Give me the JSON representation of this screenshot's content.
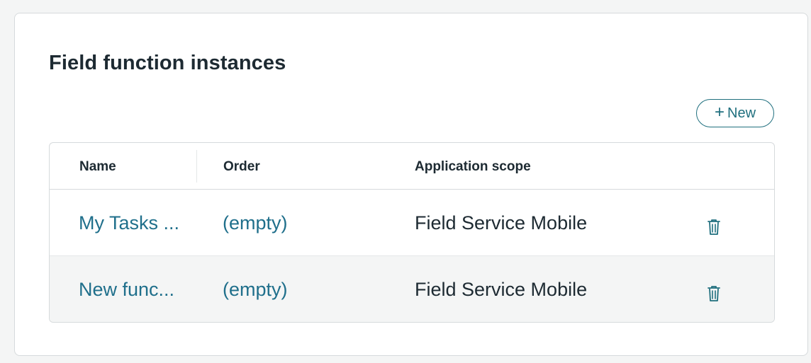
{
  "section": {
    "title": "Field function instances",
    "new_button_label": "New"
  },
  "table": {
    "columns": [
      "Name",
      "Order",
      "Application scope"
    ],
    "rows": [
      {
        "name": "My Tasks ...",
        "order": "(empty)",
        "scope": "Field Service Mobile"
      },
      {
        "name": "New func...",
        "order": "(empty)",
        "scope": "Field Service Mobile"
      }
    ]
  },
  "icons": {
    "new_button": "plus-icon",
    "row_action": "trash-icon"
  },
  "colors": {
    "link": "#1f6f8b",
    "accent": "#1f6f7e",
    "text": "#1d2a32",
    "alt_row": "#f4f5f5",
    "border": "#d6dadc"
  }
}
